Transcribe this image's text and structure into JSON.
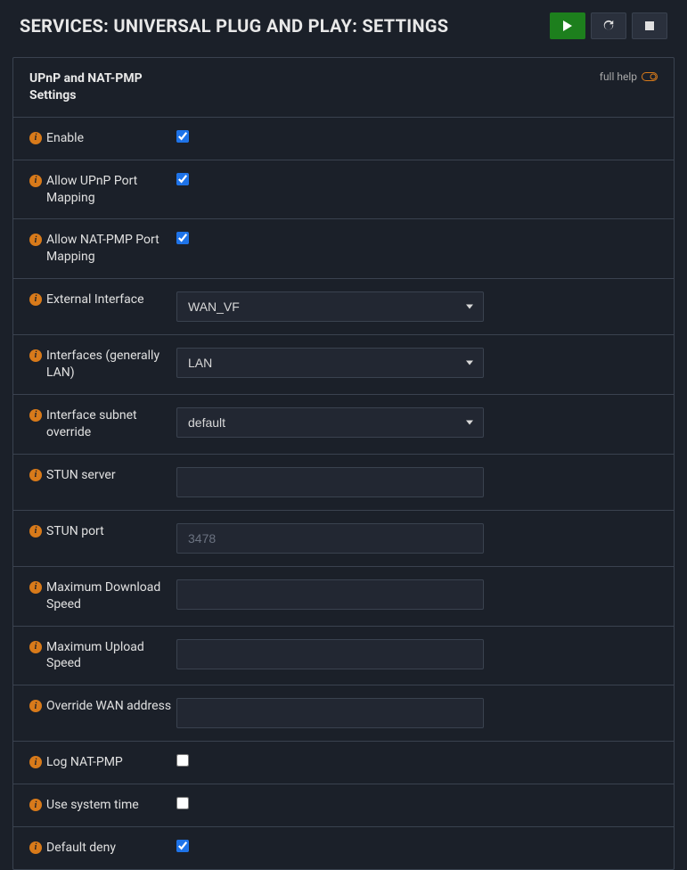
{
  "header": {
    "title": "SERVICES: UNIVERSAL PLUG AND PLAY: SETTINGS"
  },
  "panel": {
    "title": "UPnP and NAT-PMP Settings",
    "fullHelpLabel": "full help"
  },
  "fields": {
    "enable": {
      "label": "Enable",
      "checked": true
    },
    "allowUpnp": {
      "label": "Allow UPnP Port Mapping",
      "checked": true
    },
    "allowNatPmp": {
      "label": "Allow NAT-PMP Port Mapping",
      "checked": true
    },
    "externalInterface": {
      "label": "External Interface",
      "value": "WAN_VF"
    },
    "interfaces": {
      "label": "Interfaces (generally LAN)",
      "value": "LAN"
    },
    "subnetOverride": {
      "label": "Interface subnet override",
      "value": "default"
    },
    "stunServer": {
      "label": "STUN server",
      "value": "",
      "placeholder": ""
    },
    "stunPort": {
      "label": "STUN port",
      "value": "",
      "placeholder": "3478"
    },
    "maxDownload": {
      "label": "Maximum Download Speed",
      "value": "",
      "placeholder": ""
    },
    "maxUpload": {
      "label": "Maximum Upload Speed",
      "value": "",
      "placeholder": ""
    },
    "overrideWan": {
      "label": "Override WAN address",
      "value": "",
      "placeholder": ""
    },
    "logNatPmp": {
      "label": "Log NAT-PMP",
      "checked": false
    },
    "useSystemTime": {
      "label": "Use system time",
      "checked": false
    },
    "defaultDeny": {
      "label": "Default deny",
      "checked": true
    }
  }
}
